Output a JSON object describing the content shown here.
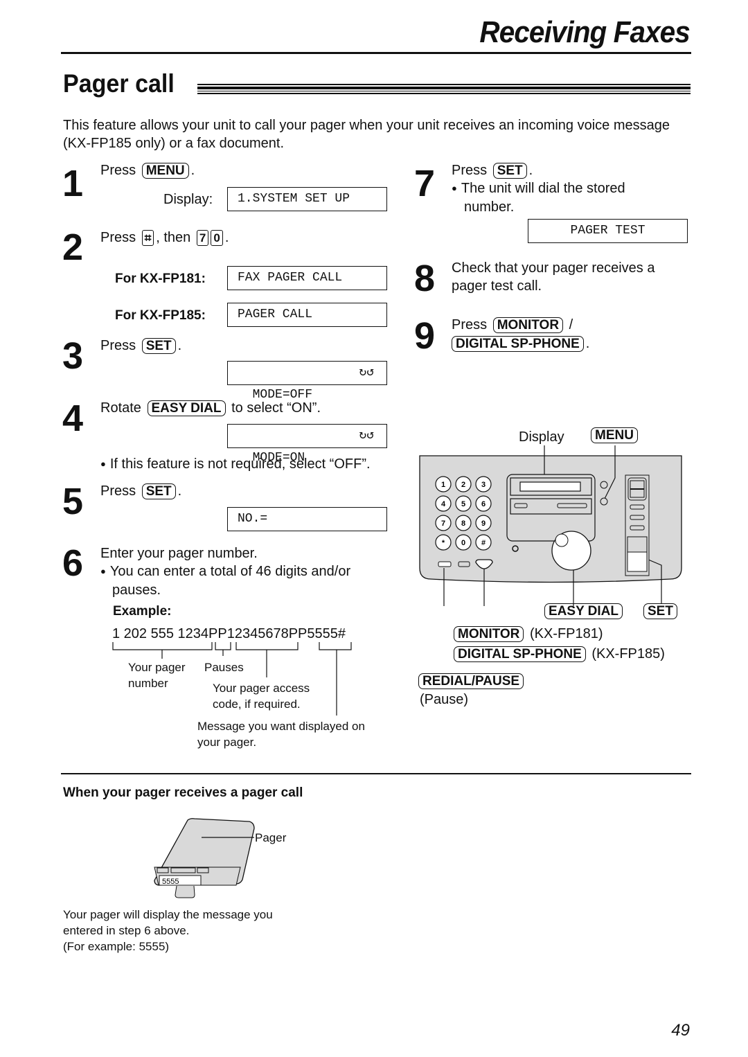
{
  "header": {
    "section_title": "Receiving Faxes",
    "page_title": "Pager call"
  },
  "intro": "This feature allows your unit to call your pager when your unit receives an incoming voice message (KX-FP185 only) or a fax document.",
  "steps": {
    "s1": {
      "num": "1",
      "press": "Press",
      "key": "MENU",
      "display_label": "Display:",
      "display": "1.SYSTEM SET UP"
    },
    "s2": {
      "num": "2",
      "press": "Press",
      "key_hash": "⌗",
      "then": ", then",
      "key_7": "7",
      "key_0": "0",
      "model_a_label": "For KX-FP181:",
      "model_a_display": "FAX PAGER CALL",
      "model_b_label": "For KX-FP185:",
      "model_b_display": "PAGER CALL"
    },
    "s3": {
      "num": "3",
      "press": "Press",
      "key": "SET",
      "display": "MODE=OFF",
      "arrows": "↻↺"
    },
    "s4": {
      "num": "4",
      "rotate": "Rotate",
      "key": "EASY DIAL",
      "suffix": "to select “ON”.",
      "display": "MODE=ON",
      "arrows": "↻↺",
      "note": "If this feature is not required, select “OFF”."
    },
    "s5": {
      "num": "5",
      "press": "Press",
      "key": "SET",
      "display": "NO.="
    },
    "s6": {
      "num": "6",
      "text": "Enter your pager number.",
      "note_l1": "You can enter a total of 46 digits and/or",
      "note_l2": "pauses.",
      "example_label": "Example:",
      "example": "1 202 555 1234PP12345678PP5555#",
      "callout_pager_l1": "Your pager",
      "callout_pager_l2": "number",
      "callout_pauses": "Pauses",
      "callout_access_l1": "Your pager access",
      "callout_access_l2": "code, if required.",
      "callout_message_l1": "Message you want displayed on",
      "callout_message_l2": "your pager."
    },
    "s7": {
      "num": "7",
      "press": "Press",
      "key": "SET",
      "note_l1": "The unit will dial the stored",
      "note_l2": "number.",
      "display": "PAGER TEST"
    },
    "s8": {
      "num": "8",
      "text_l1": "Check that your pager receives a",
      "text_l2": "pager test call."
    },
    "s9": {
      "num": "9",
      "press": "Press",
      "key_a": "MONITOR",
      "slash": "/",
      "key_b": "DIGITAL SP-PHONE"
    }
  },
  "panel": {
    "display_label": "Display",
    "menu_key": "MENU",
    "keypad": [
      "1",
      "2",
      "3",
      "4",
      "5",
      "6",
      "7",
      "8",
      "9",
      "*",
      "0",
      "#"
    ],
    "easy_dial_key": "EASY DIAL",
    "set_key": "SET",
    "monitor_key": "MONITOR",
    "monitor_model": "(KX-FP181)",
    "digital_key": "DIGITAL SP-PHONE",
    "digital_model": "(KX-FP185)",
    "redial_key": "REDIAL/PAUSE",
    "redial_note": "(Pause)"
  },
  "pager_section": {
    "heading": "When your pager receives a pager call",
    "pager_label": "Pager",
    "pager_screen": "5555",
    "caption_l1": "Your pager will display the message you",
    "caption_l2": "entered in step 6 above.",
    "caption_l3": "(For example: 5555)"
  },
  "page_number": "49",
  "colors": {
    "panel_fill": "#d9d9d9",
    "ink": "#111111"
  }
}
